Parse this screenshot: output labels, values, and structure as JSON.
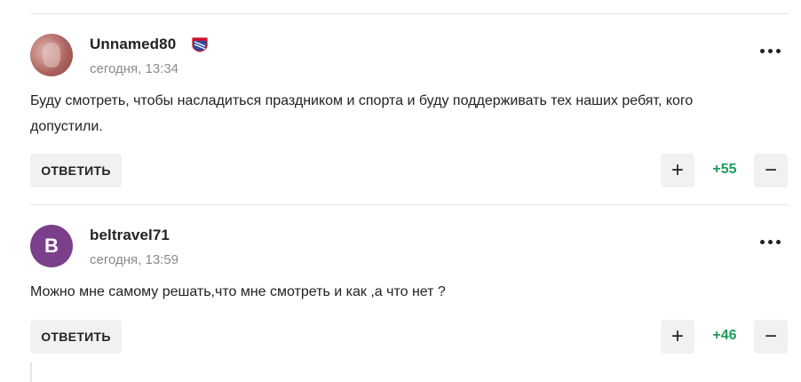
{
  "comments": [
    {
      "username": "Unnamed80",
      "badge_icon": "ny-rangers-logo-icon",
      "time": "сегодня, 13:34",
      "text": "Буду смотреть, чтобы насладиться праздником и спорта и буду поддерживать тех наших ребят, кого допустили.",
      "reply_label": "ОТВЕТИТЬ",
      "plus_label": "+",
      "score": "+55",
      "minus_label": "−"
    },
    {
      "username": "beltravel71",
      "avatar_letter": "B",
      "avatar_color": "#7b3f8c",
      "time": "сегодня, 13:59",
      "text": "Можно мне самому решать,что мне смотреть и как ,а что нет ?",
      "reply_label": "ОТВЕТИТЬ",
      "plus_label": "+",
      "score": "+46",
      "minus_label": "−"
    }
  ],
  "colors": {
    "score_positive": "#1f9a5c",
    "button_bg": "#f1f1f1",
    "divider": "#e6e6e6"
  }
}
